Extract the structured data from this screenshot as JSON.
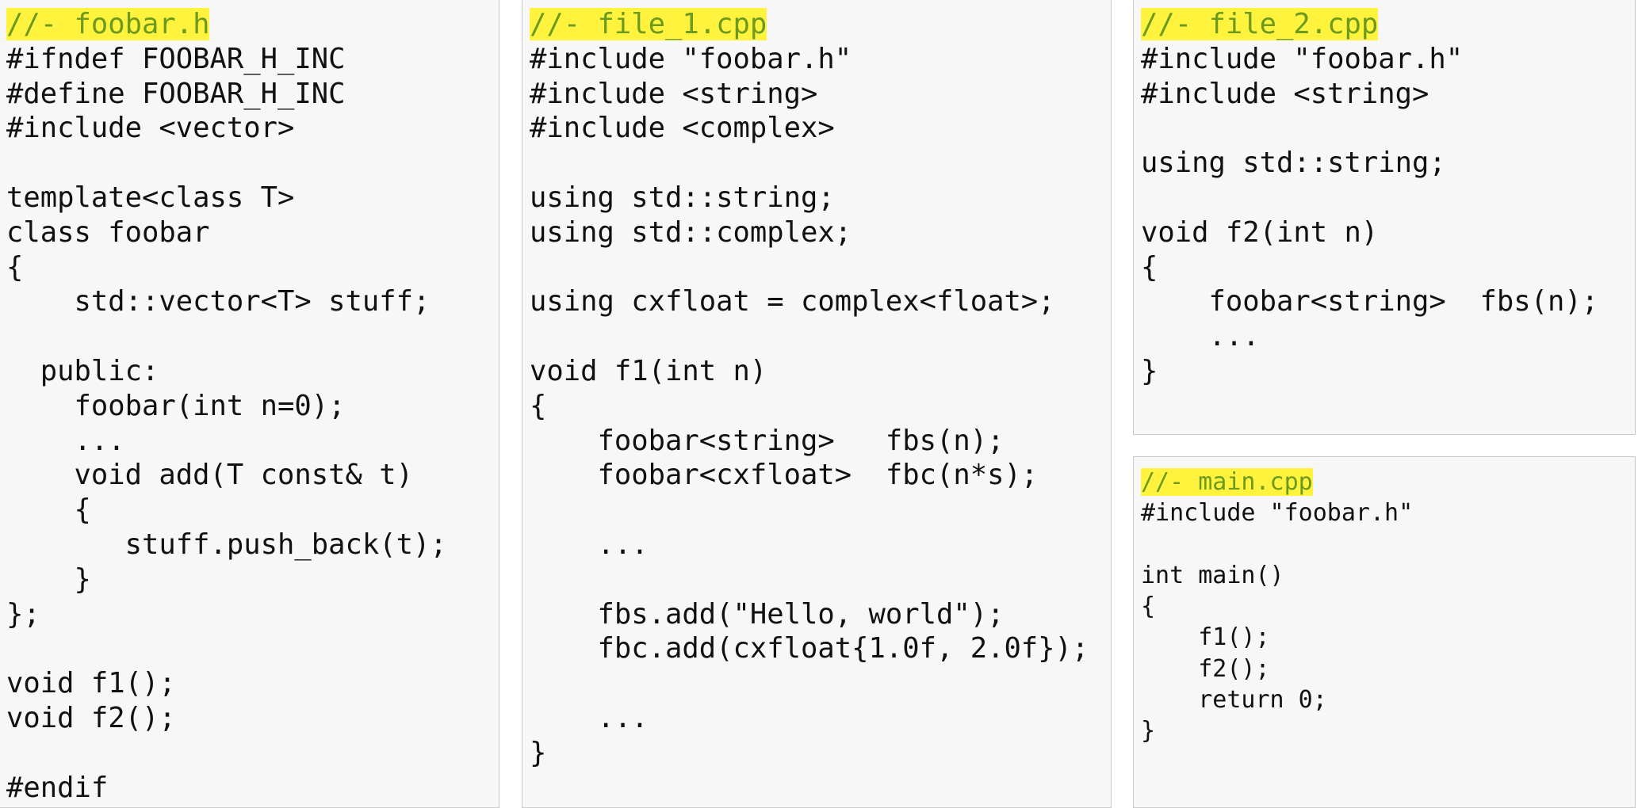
{
  "colors": {
    "panel_background": "#f7f7f7",
    "panel_border": "#c9c9c9",
    "code_text": "#111111",
    "comment_text": "#6b9a1e",
    "highlight": "#fff33d"
  },
  "panels": [
    {
      "id": "foobar-h",
      "title": "//- foobar.h",
      "code": "#ifndef FOOBAR_H_INC\n#define FOOBAR_H_INC\n#include <vector>\n\ntemplate<class T>\nclass foobar\n{\n    std::vector<T> stuff;\n\n  public:\n    foobar(int n=0);\n    ...\n    void add(T const& t)\n    {\n       stuff.push_back(t);\n    }\n};\n\nvoid f1();\nvoid f2();\n\n#endif"
    },
    {
      "id": "file-1-cpp",
      "title": "//- file_1.cpp",
      "code": "#include \"foobar.h\"\n#include <string>\n#include <complex>\n\nusing std::string;\nusing std::complex;\n\nusing cxfloat = complex<float>;\n\nvoid f1(int n)\n{\n    foobar<string>   fbs(n);\n    foobar<cxfloat>  fbc(n*s);\n\n    ...\n\n    fbs.add(\"Hello, world\");\n    fbc.add(cxfloat{1.0f, 2.0f});\n\n    ...\n}"
    },
    {
      "id": "file-2-cpp",
      "title": "//- file_2.cpp",
      "code": "#include \"foobar.h\"\n#include <string>\n\nusing std::string;\n\nvoid f2(int n)\n{\n    foobar<string>  fbs(n);\n    ...\n}"
    },
    {
      "id": "main-cpp",
      "title": "//- main.cpp",
      "code": "#include \"foobar.h\"\n\nint main()\n{\n    f1();\n    f2();\n    return 0;\n}"
    }
  ]
}
